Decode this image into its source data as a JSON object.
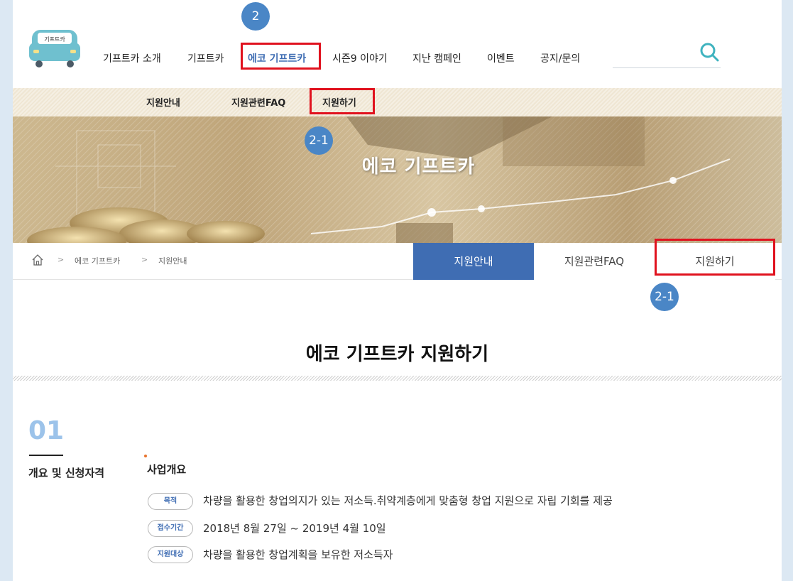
{
  "nav": {
    "items": [
      "기프트카 소개",
      "기프트카",
      "에코 기프트카",
      "시즌9 이야기",
      "지난 캠페인",
      "이벤트",
      "공지/문의"
    ],
    "logo_text": "기프트카",
    "search_icon": "search-icon"
  },
  "subnav": {
    "items": [
      "지원안내",
      "지원관련FAQ",
      "지원하기"
    ]
  },
  "banner": {
    "title": "에코 기프트카"
  },
  "breadcrumb": {
    "items": [
      "에코 기프트카",
      "지원안내"
    ],
    "separator": ">",
    "home_icon": "home-icon"
  },
  "tabs": [
    "지원안내",
    "지원관련FAQ",
    "지원하기"
  ],
  "page": {
    "title": "에코 기프트카 지원하기"
  },
  "section": {
    "number": "01",
    "label": "개요 및 신청자격",
    "heading": "사업개요",
    "rows": [
      {
        "tag": "목적",
        "text": "차량을 활용한 창업의지가 있는 저소득.취약계층에게 맞춤형 창업 지원으로 자립 기회를 제공"
      },
      {
        "tag": "접수기간",
        "text": "2018년 8월 27일 ~ 2019년 4월 10일"
      },
      {
        "tag": "지원대상",
        "text": "차량을 활용한 창업계획을 보유한 저소득자"
      }
    ]
  },
  "annotations": {
    "nav_badge": "2",
    "subnav_badge": "2-1",
    "tab_badge": "2-1"
  },
  "colors": {
    "accent": "#3f6db3",
    "badge": "#4a86c6",
    "highlight": "#e0121e",
    "section_number": "#9cc3ea",
    "background": "#dce8f3"
  }
}
